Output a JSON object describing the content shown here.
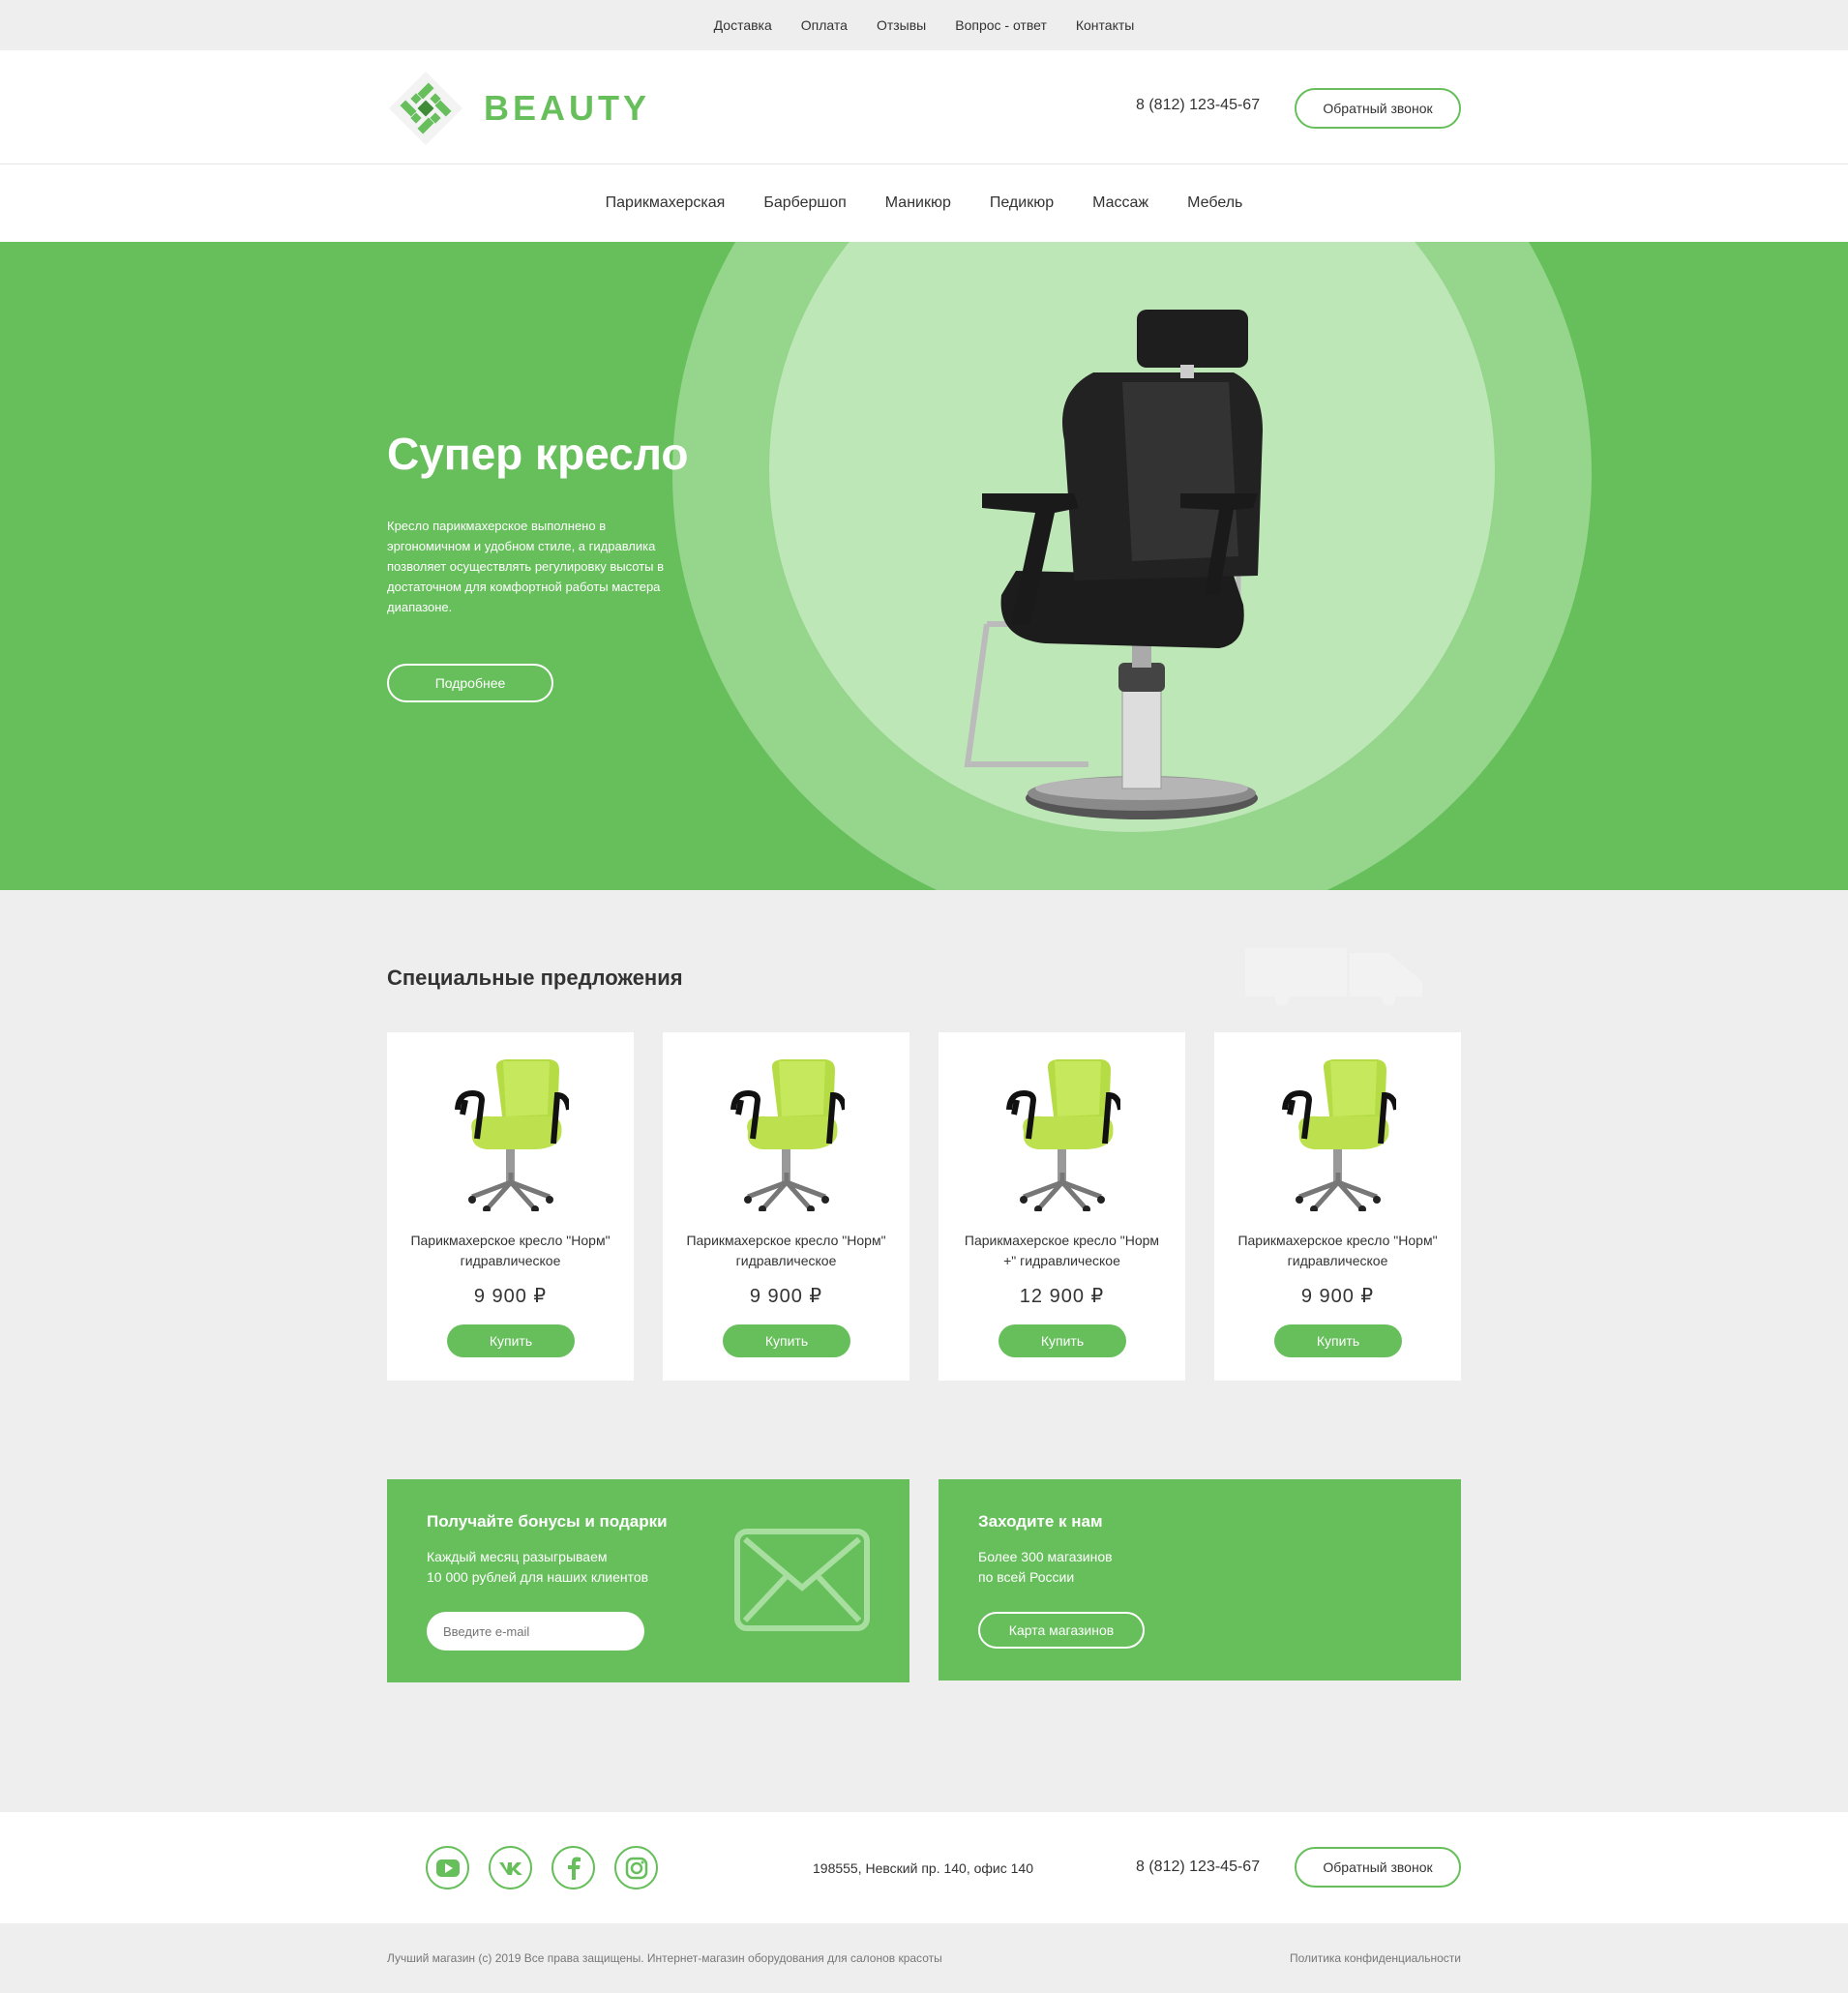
{
  "topbar": {
    "links": [
      "Доставка",
      "Оплата",
      "Отзывы",
      "Вопрос - ответ",
      "Контакты"
    ]
  },
  "header": {
    "logo_text": "BEAUTY",
    "phone": "8 (812) 123-45-67",
    "callback_label": "Обратный звонок"
  },
  "nav": {
    "items": [
      "Парикмахерская",
      "Барбершоп",
      "Маникюр",
      "Педикюр",
      "Массаж",
      "Мебель"
    ]
  },
  "hero": {
    "title": "Супер кресло",
    "description": "Кресло парикмахерское выполнено в эргономичном и удобном стиле, а гидравлика позволяет осуществлять регулировку высоты в достаточном для комфортной работы мастера диапазоне.",
    "button_label": "Подробнее"
  },
  "offers": {
    "title": "Специальные предложения",
    "products": [
      {
        "name": "Парикмахерское кресло \"Норм\" гидравлическое",
        "price": "9 900 ₽",
        "buy_label": "Купить"
      },
      {
        "name": "Парикмахерское кресло \"Норм\" гидравлическое",
        "price": "9 900 ₽",
        "buy_label": "Купить"
      },
      {
        "name": "Парикмахерское кресло \"Норм +\" гидравлическое",
        "price": "12 900 ₽",
        "buy_label": "Купить"
      },
      {
        "name": "Парикмахерское кресло \"Норм\" гидравлическое",
        "price": "9 900 ₽",
        "buy_label": "Купить"
      }
    ]
  },
  "bonus": {
    "title": "Получайте бонусы и подарки",
    "text_line1": "Каждый месяц разыгрываем",
    "text_line2": "10 000 рублей для наших клиентов",
    "email_placeholder": "Введите e-mail"
  },
  "stores": {
    "title": "Заходите к нам",
    "text_line1": "Более 300 магазинов",
    "text_line2": "по всей России",
    "button_label": "Карта магазинов"
  },
  "footer": {
    "socials": [
      "youtube-icon",
      "vk-icon",
      "facebook-icon",
      "instagram-icon"
    ],
    "address": "198555, Невский пр. 140, офис 140",
    "phone": "8 (812) 123-45-67",
    "callback_label": "Обратный звонок",
    "copyright": "Лучший магазин (c) 2019 Все права защищены. Интернет-магазин оборудования для салонов красоты",
    "policy": "Политика конфиденциальности"
  },
  "colors": {
    "accent": "#67bf5c",
    "accent_light": "#95d58c",
    "accent_pale": "#bee7b7",
    "background": "#eeeeee"
  }
}
